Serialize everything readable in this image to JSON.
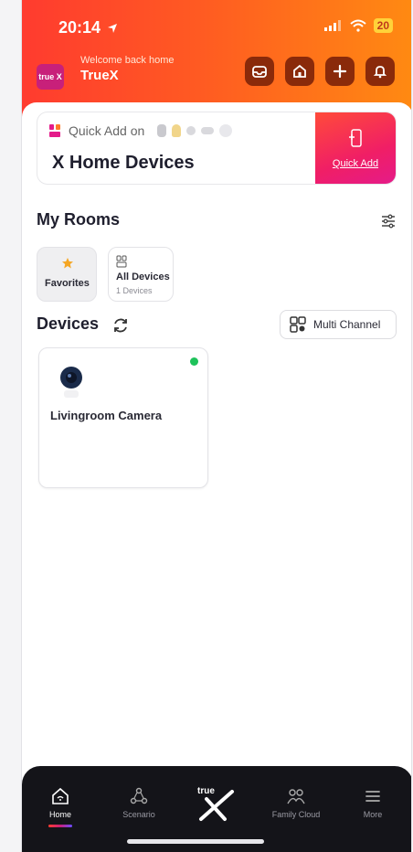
{
  "status": {
    "time": "20:14",
    "battery": "20"
  },
  "header": {
    "welcome": "Welcome back home",
    "app_name": "TrueX",
    "brand_logo_text": "true X"
  },
  "quick_add": {
    "prefix": "Quick Add on",
    "title": "X Home Devices",
    "button_label": "Quick Add"
  },
  "rooms": {
    "title": "My Rooms",
    "items": [
      {
        "label": "Favorites",
        "sub": ""
      },
      {
        "label": "All Devices",
        "sub": "1 Devices"
      }
    ]
  },
  "devices": {
    "title": "Devices",
    "multi_channel_label": "Multi Channel",
    "items": [
      {
        "name": "Livingroom Camera",
        "online": true
      }
    ]
  },
  "tabs": {
    "home": "Home",
    "scenario": "Scenario",
    "family_cloud": "Family Cloud",
    "more": "More",
    "center_logo": "true"
  },
  "colors": {
    "header_start": "#ff3b2f",
    "header_end": "#ff8a12",
    "accent_pink": "#e41b8a",
    "online": "#1ec25a",
    "tabbar": "#141419"
  },
  "icons": [
    "location-arrow-icon",
    "signal-icon",
    "wifi-icon",
    "inbox-icon",
    "home-icon",
    "plus-icon",
    "bell-icon",
    "filter-icon",
    "refresh-icon",
    "multi-channel-icon",
    "camera-icon",
    "scenario-icon",
    "family-cloud-icon",
    "menu-icon"
  ]
}
